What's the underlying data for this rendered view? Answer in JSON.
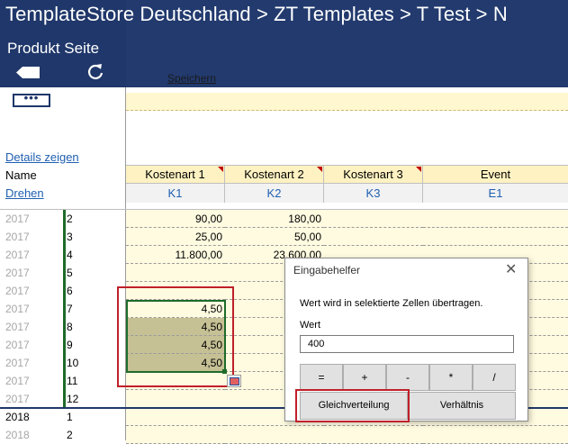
{
  "header": {
    "breadcrumb": "TemplateStore Deutschland > ZT  Templates > T  Test > N",
    "subtitle": "Produkt Seite",
    "save_label": "Speichern",
    "more_label": "•••",
    "back_icon": "back-arrow-icon",
    "refresh_icon": "refresh-icon"
  },
  "left": {
    "details_link": "Details zeigen",
    "name_label": "Name",
    "drehen_link": "Drehen"
  },
  "columns": [
    {
      "label": "Kostenart 1",
      "code": "K1"
    },
    {
      "label": "Kostenart 2",
      "code": "K2"
    },
    {
      "label": "Kostenart 3",
      "code": "K3"
    },
    {
      "label": "Event",
      "code": "E1"
    }
  ],
  "rows": [
    {
      "year": "2017",
      "month": "2",
      "k1": "90,00",
      "k2": "180,00"
    },
    {
      "year": "2017",
      "month": "3",
      "k1": "25,00",
      "k2": "50,00"
    },
    {
      "year": "2017",
      "month": "4",
      "k1": "11.800,00",
      "k2": "23.600,00"
    },
    {
      "year": "2017",
      "month": "5",
      "k1": "",
      "k2": ""
    },
    {
      "year": "2017",
      "month": "6",
      "k1": "",
      "k2": ""
    },
    {
      "year": "2017",
      "month": "7",
      "k1": "4,50",
      "k2": ""
    },
    {
      "year": "2017",
      "month": "8",
      "k1": "4,50",
      "k2": ""
    },
    {
      "year": "2017",
      "month": "9",
      "k1": "4,50",
      "k2": ""
    },
    {
      "year": "2017",
      "month": "10",
      "k1": "4,50",
      "k2": ""
    },
    {
      "year": "2017",
      "month": "11",
      "k1": "",
      "k2": ""
    },
    {
      "year": "2017",
      "month": "12",
      "k1": "",
      "k2": ""
    },
    {
      "year": "2018",
      "month": "1",
      "k1": "",
      "k2": ""
    },
    {
      "year": "2018",
      "month": "2",
      "k1": "",
      "k2": ""
    }
  ],
  "dialog": {
    "title": "Eingabehelfer",
    "close": "✕",
    "message": "Wert wird in selektierte Zellen übertragen.",
    "wert_label": "Wert",
    "wert_value": "400",
    "ops": [
      "=",
      "+",
      "-",
      "*",
      "/"
    ],
    "gleich_label": "Gleichverteilung",
    "verhaeltnis_label": "Verhältnis"
  },
  "colors": {
    "header_bg": "#223a6e",
    "selection": "#1e6b2a",
    "highlight": "#c0202a",
    "cell_bg": "#fffbe0"
  }
}
